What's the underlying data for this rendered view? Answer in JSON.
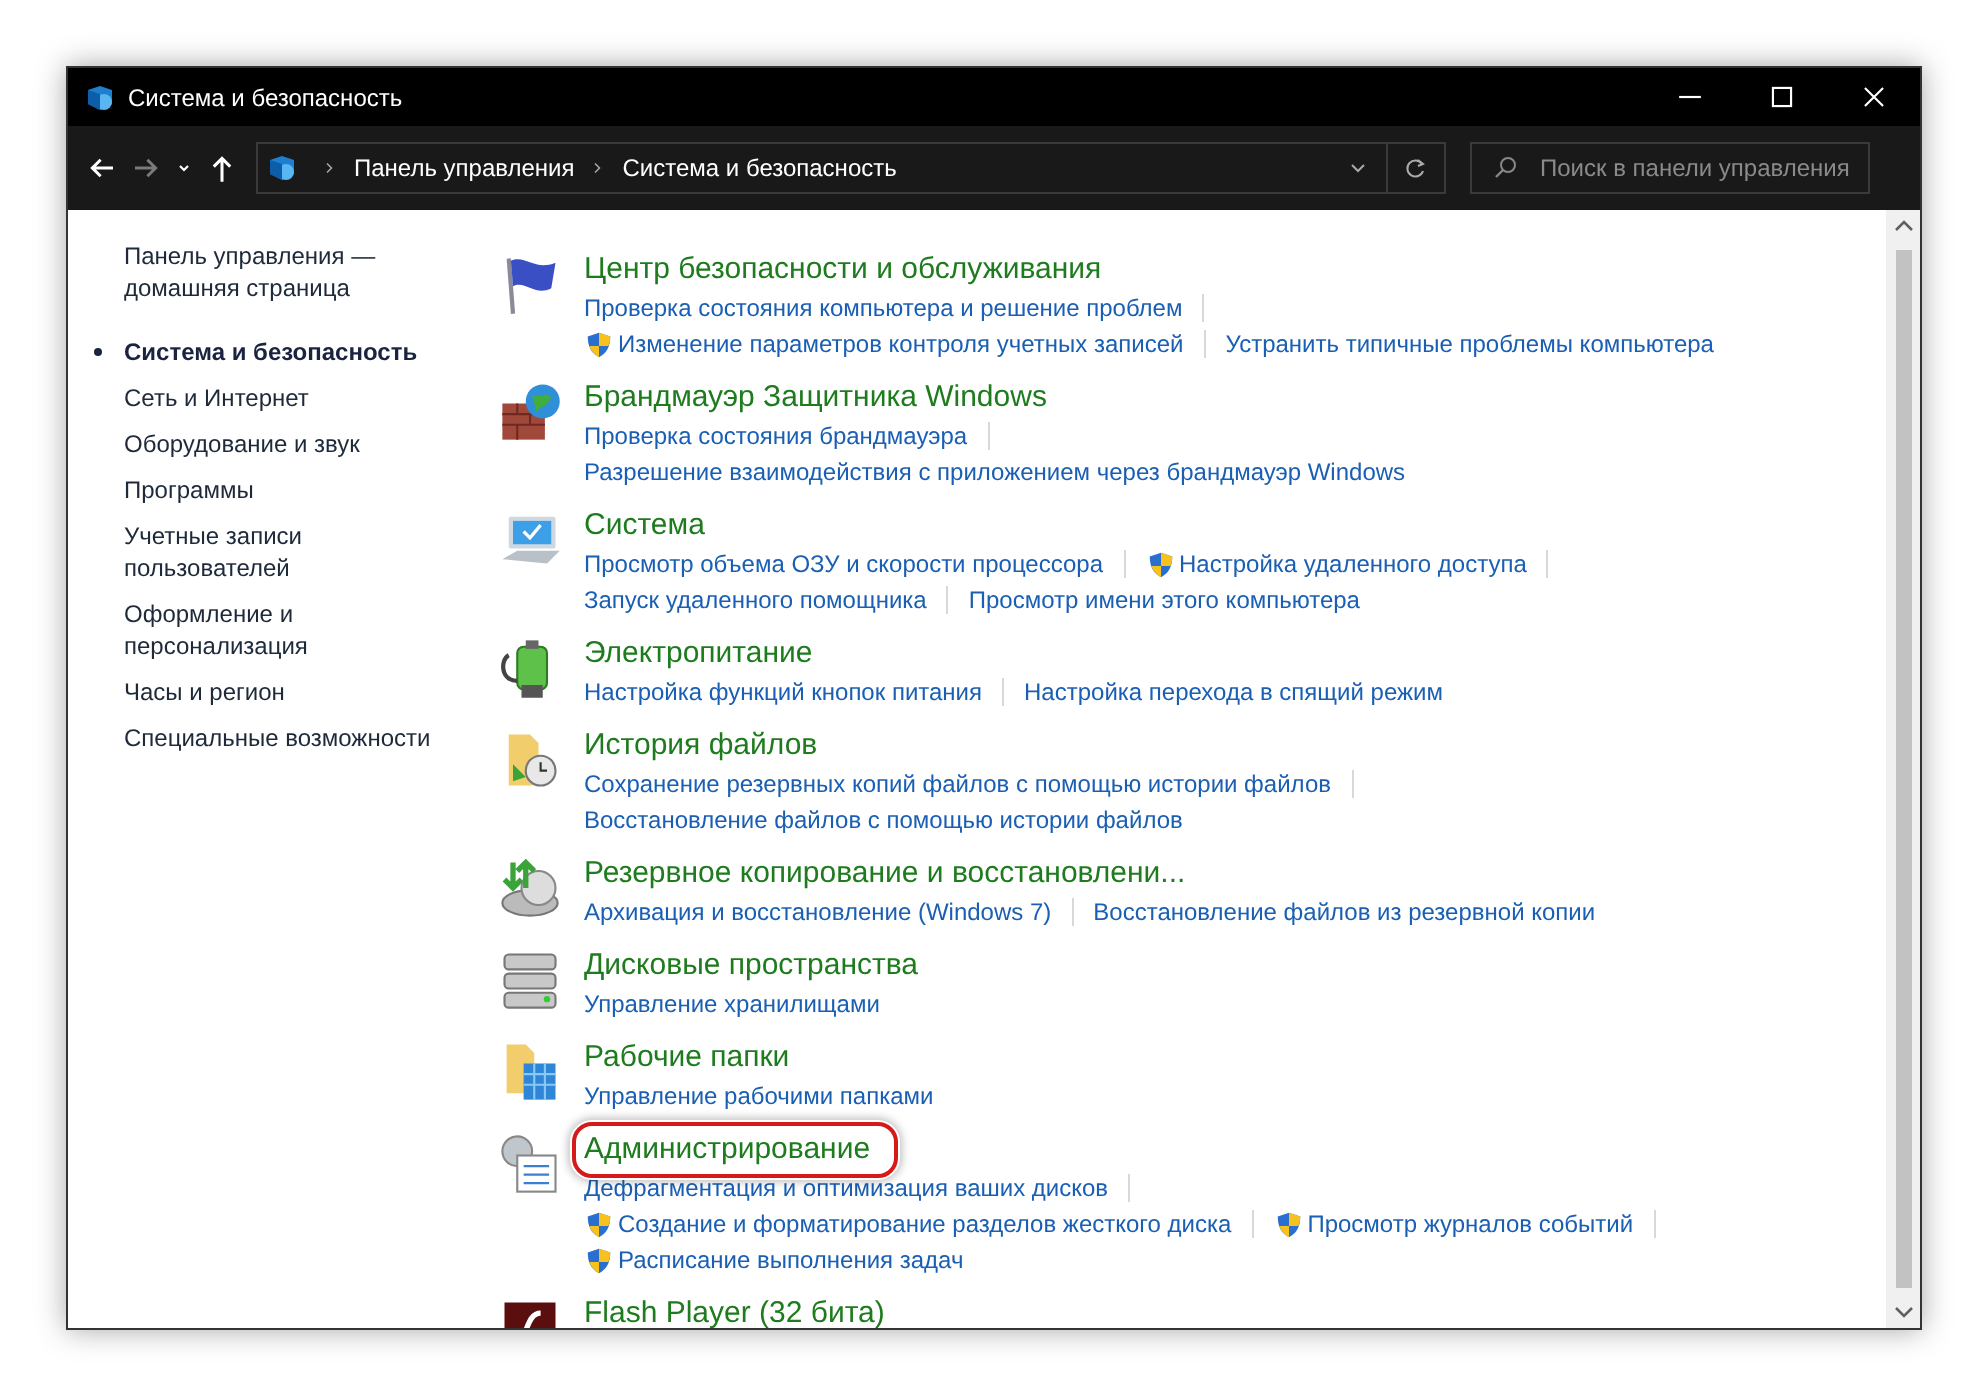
{
  "window": {
    "title": "Система и безопасность"
  },
  "nav_buttons": [
    {
      "kind": "back",
      "disabled": false
    },
    {
      "kind": "forward",
      "disabled": true
    },
    {
      "kind": "recent",
      "disabled": false
    },
    {
      "kind": "up",
      "disabled": false
    }
  ],
  "breadcrumb": [
    "Панель управления",
    "Система и безопасность"
  ],
  "search": {
    "placeholder": "Поиск в панели управления"
  },
  "sidebar": {
    "items": [
      {
        "label": "Панель управления — домашняя страница",
        "selected": false
      },
      {
        "label": "Система и безопасность",
        "selected": true
      },
      {
        "label": "Сеть и Интернет",
        "selected": false
      },
      {
        "label": "Оборудование и звук",
        "selected": false
      },
      {
        "label": "Программы",
        "selected": false
      },
      {
        "label": "Учетные записи пользователей",
        "selected": false
      },
      {
        "label": "Оформление и персонализация",
        "selected": false
      },
      {
        "label": "Часы и регион",
        "selected": false
      },
      {
        "label": "Специальные возможности",
        "selected": false
      }
    ]
  },
  "categories": [
    {
      "title": "Центр безопасности и обслуживания",
      "highlighted": false,
      "lines": [
        [
          {
            "text": "Проверка состояния компьютера и решение проблем",
            "shield": false
          }
        ],
        [
          {
            "text": "Изменение параметров контроля учетных записей",
            "shield": true
          },
          {
            "text": "Устранить типичные проблемы компьютера",
            "shield": false
          }
        ]
      ]
    },
    {
      "title": "Брандмауэр Защитника Windows",
      "highlighted": false,
      "lines": [
        [
          {
            "text": "Проверка состояния брандмауэра",
            "shield": false
          }
        ],
        [
          {
            "text": "Разрешение взаимодействия с приложением через брандмауэр Windows",
            "shield": false
          }
        ]
      ]
    },
    {
      "title": "Система",
      "highlighted": false,
      "lines": [
        [
          {
            "text": "Просмотр объема ОЗУ и скорости процессора",
            "shield": false
          },
          {
            "text": "Настройка удаленного доступа",
            "shield": true
          }
        ],
        [
          {
            "text": "Запуск удаленного помощника",
            "shield": false
          },
          {
            "text": "Просмотр имени этого компьютера",
            "shield": false
          }
        ]
      ]
    },
    {
      "title": "Электропитание",
      "highlighted": false,
      "lines": [
        [
          {
            "text": "Настройка функций кнопок питания",
            "shield": false
          },
          {
            "text": "Настройка перехода в спящий режим",
            "shield": false
          }
        ]
      ]
    },
    {
      "title": "История файлов",
      "highlighted": false,
      "lines": [
        [
          {
            "text": "Сохранение резервных копий файлов с помощью истории файлов",
            "shield": false
          }
        ],
        [
          {
            "text": "Восстановление файлов с помощью истории файлов",
            "shield": false
          }
        ]
      ]
    },
    {
      "title": "Резервное копирование и восстановлени...",
      "highlighted": false,
      "lines": [
        [
          {
            "text": "Архивация и восстановление (Windows 7)",
            "shield": false
          },
          {
            "text": "Восстановление файлов из резервной копии",
            "shield": false
          }
        ]
      ]
    },
    {
      "title": "Дисковые пространства",
      "highlighted": false,
      "lines": [
        [
          {
            "text": "Управление хранилищами",
            "shield": false
          }
        ]
      ]
    },
    {
      "title": "Рабочие папки",
      "highlighted": false,
      "lines": [
        [
          {
            "text": "Управление рабочими папками",
            "shield": false
          }
        ]
      ]
    },
    {
      "title": "Администрирование",
      "highlighted": true,
      "lines": [
        [
          {
            "text": "Дефрагментация и оптимизация ваших дисков",
            "shield": false
          }
        ],
        [
          {
            "text": "Создание и форматирование разделов жесткого диска",
            "shield": true
          },
          {
            "text": "Просмотр журналов событий",
            "shield": true
          }
        ],
        [
          {
            "text": "Расписание выполнения задач",
            "shield": true
          }
        ]
      ]
    },
    {
      "title": "Flash Player (32 бита)",
      "highlighted": false
    }
  ]
}
